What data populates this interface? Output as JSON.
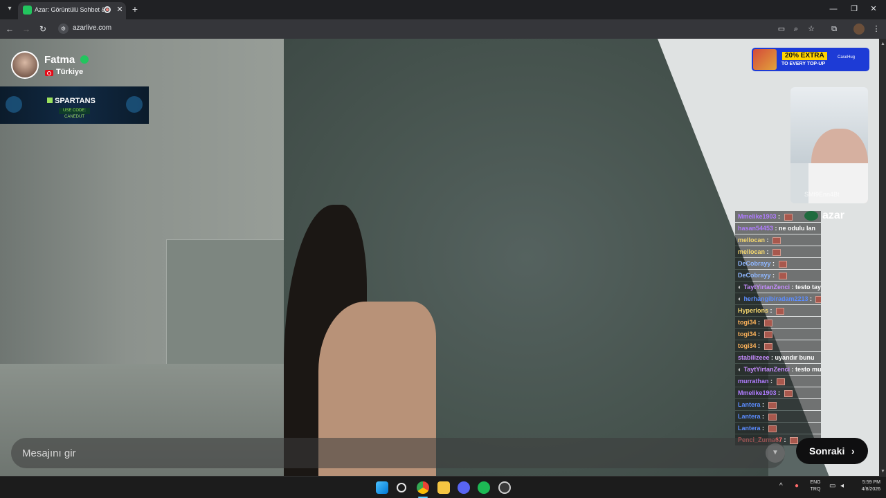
{
  "browser": {
    "tab_title": "Azar: Görüntülü Sohbet & ",
    "tab_close": "✕",
    "new_tab": "+",
    "url": "azarlive.com",
    "window": {
      "minimize": "—",
      "restore": "❐",
      "close": "✕"
    }
  },
  "caller": {
    "name": "Fatma",
    "country": "Türkiye"
  },
  "banner": {
    "title": "SPARTANS",
    "subtitle": "USE CODE: CANEDUT"
  },
  "promo": {
    "headline": "20% EXTRA",
    "subline": "TO EVERY TOP-UP",
    "brand": "CaseHug"
  },
  "self_view": {
    "user_id": "SMf9Enn4Bt"
  },
  "azar_logo": "azar",
  "chat": {
    "messages": [
      {
        "user": "Mmelike1903",
        "message": "",
        "color": "#b07cff",
        "emote": true,
        "badge": false
      },
      {
        "user": "hasan54453",
        "message": "ne odulu lan",
        "color": "#b07cff",
        "emote": false,
        "badge": false
      },
      {
        "user": "mellocan",
        "message": "",
        "color": "#f5d76e",
        "emote": true,
        "badge": false
      },
      {
        "user": "mellocan",
        "message": "",
        "color": "#f5d76e",
        "emote": true,
        "badge": false
      },
      {
        "user": "DeCobrayy",
        "message": "",
        "color": "#8fb7ff",
        "emote": true,
        "badge": false
      },
      {
        "user": "DeCobrayy",
        "message": "",
        "color": "#8fb7ff",
        "emote": true,
        "badge": false
      },
      {
        "user": "TaytYirtanZenci",
        "message": "testo taylan",
        "color": "#c68cff",
        "emote": false,
        "badge": true
      },
      {
        "user": "herhangibiradam2213",
        "message": "",
        "color": "#5b8cff",
        "emote": true,
        "badge": true
      },
      {
        "user": "HyperIons",
        "message": "",
        "color": "#f5d76e",
        "emote": true,
        "badge": false
      },
      {
        "user": "togi34",
        "message": "",
        "color": "#ffb35a",
        "emote": true,
        "badge": false
      },
      {
        "user": "togi34",
        "message": "",
        "color": "#ffb35a",
        "emote": true,
        "badge": false
      },
      {
        "user": "togi34",
        "message": "",
        "color": "#ffb35a",
        "emote": true,
        "badge": false
      },
      {
        "user": "stabilizeee",
        "message": "uyandır bunu",
        "color": "#c68cff",
        "emote": false,
        "badge": false
      },
      {
        "user": "TaytYirtanZenci",
        "message": "testo mu bu",
        "color": "#c68cff",
        "emote": false,
        "badge": true
      },
      {
        "user": "murrathan",
        "message": "",
        "color": "#b07cff",
        "emote": true,
        "badge": false
      },
      {
        "user": "Mmelike1903",
        "message": "",
        "color": "#b07cff",
        "emote": true,
        "badge": false
      },
      {
        "user": "Lantera",
        "message": "",
        "color": "#5b8cff",
        "emote": true,
        "badge": false
      },
      {
        "user": "Lantera",
        "message": "",
        "color": "#5b8cff",
        "emote": true,
        "badge": false
      },
      {
        "user": "Lantera",
        "message": "",
        "color": "#5b8cff",
        "emote": true,
        "badge": false
      },
      {
        "user": "Penci_Zurna67",
        "message": "",
        "color": "#ff6b6b",
        "emote": true,
        "badge": false
      }
    ]
  },
  "input": {
    "placeholder": "Mesajını gir"
  },
  "next_button": {
    "label": "Sonraki",
    "chevron": "›"
  },
  "taskbar": {
    "lang_top": "ENG",
    "lang_bottom": "TRQ",
    "time": "5:59 PM",
    "date": "4/8/2026"
  }
}
